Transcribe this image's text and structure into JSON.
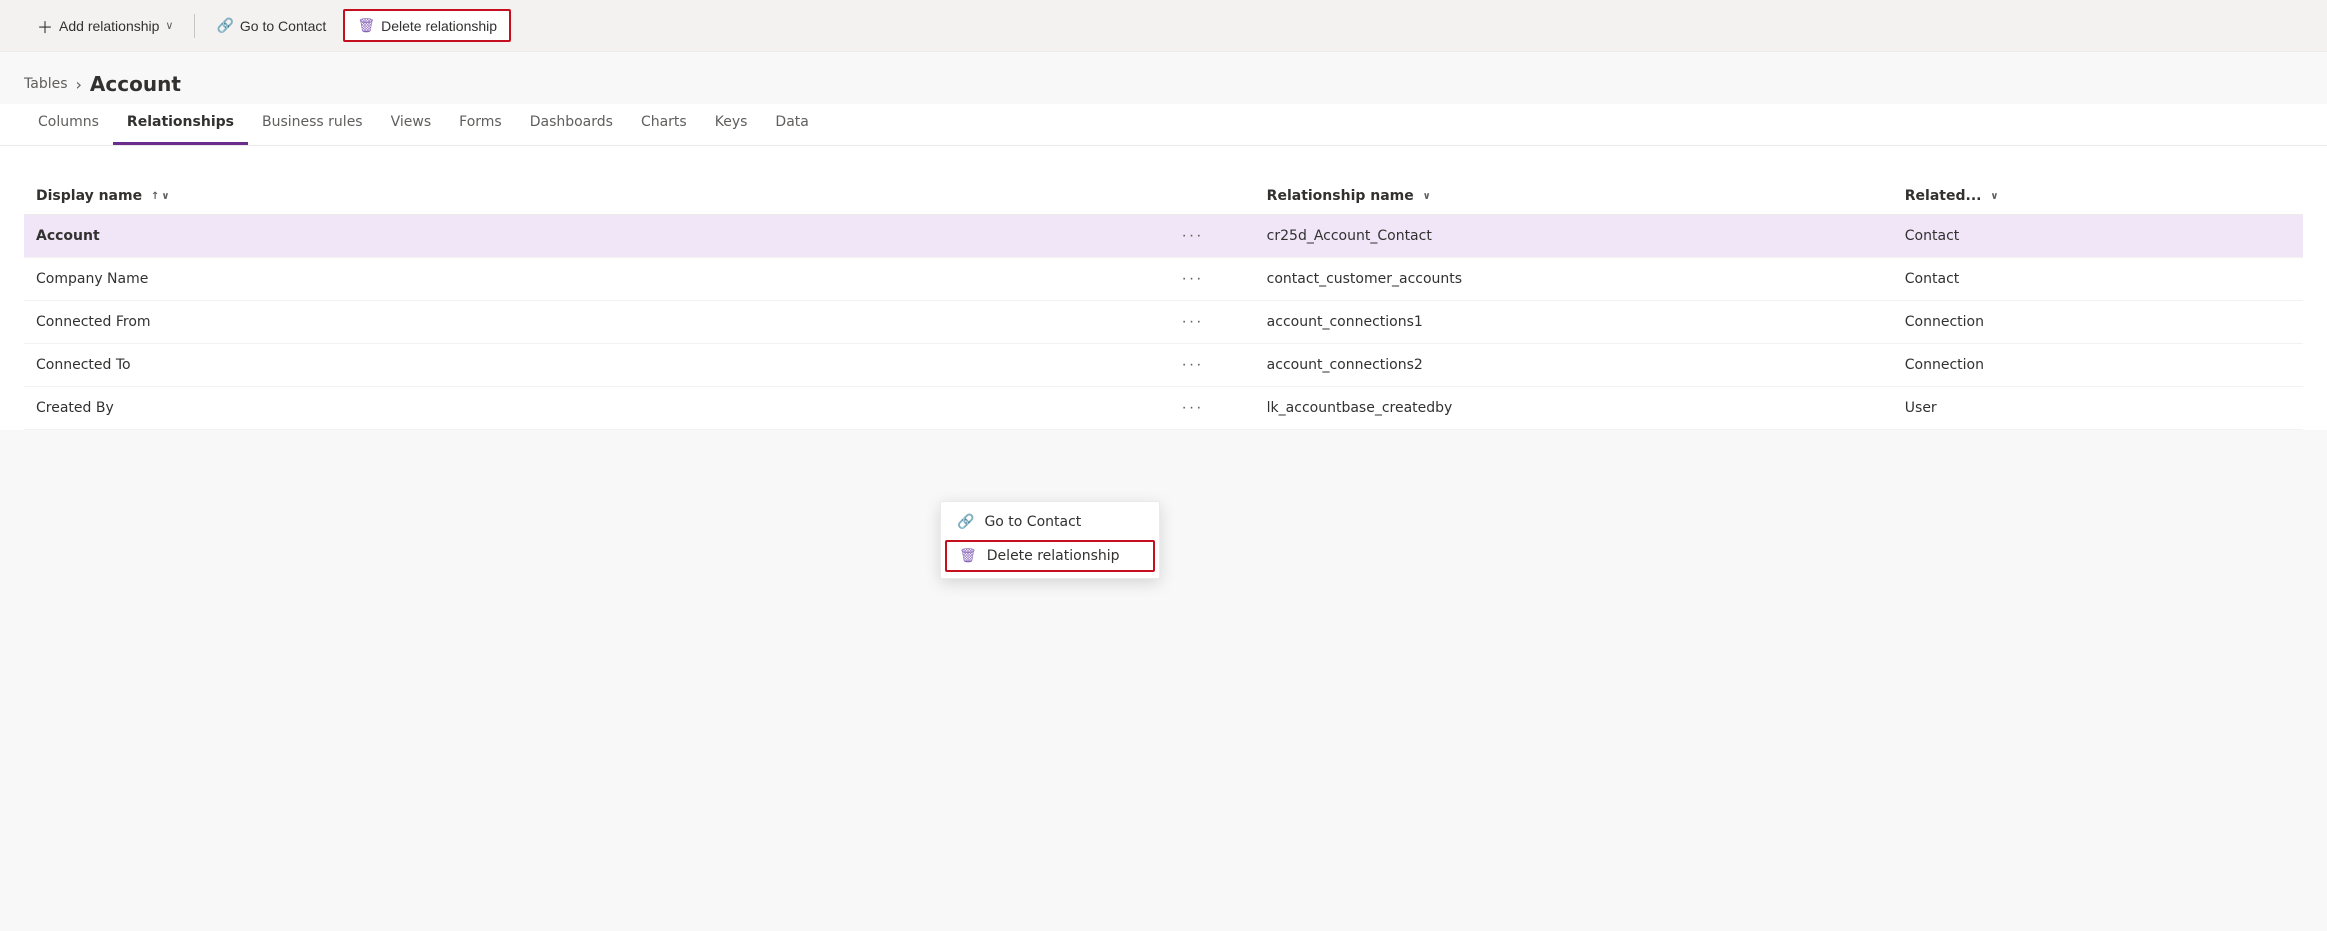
{
  "toolbar": {
    "add_relationship_label": "Add relationship",
    "add_chevron": "∨",
    "go_to_contact_label": "Go to Contact",
    "delete_relationship_label": "Delete relationship"
  },
  "breadcrumb": {
    "parent_label": "Tables",
    "separator": "›",
    "current_label": "Account"
  },
  "tabs": [
    {
      "id": "columns",
      "label": "Columns",
      "active": false
    },
    {
      "id": "relationships",
      "label": "Relationships",
      "active": true
    },
    {
      "id": "business-rules",
      "label": "Business rules",
      "active": false
    },
    {
      "id": "views",
      "label": "Views",
      "active": false
    },
    {
      "id": "forms",
      "label": "Forms",
      "active": false
    },
    {
      "id": "dashboards",
      "label": "Dashboards",
      "active": false
    },
    {
      "id": "charts",
      "label": "Charts",
      "active": false
    },
    {
      "id": "keys",
      "label": "Keys",
      "active": false
    },
    {
      "id": "data",
      "label": "Data",
      "active": false
    }
  ],
  "table": {
    "columns": [
      {
        "id": "display-name",
        "label": "Display name",
        "sortable": true
      },
      {
        "id": "actions",
        "label": "",
        "sortable": false
      },
      {
        "id": "relationship-name",
        "label": "Relationship name",
        "sortable": true
      },
      {
        "id": "related",
        "label": "Related...",
        "sortable": true
      }
    ],
    "rows": [
      {
        "id": "row-1",
        "display_name": "Account",
        "selected": true,
        "dots": "···",
        "rel_name": "cr25d_Account_Contact",
        "related": "Contact"
      },
      {
        "id": "row-2",
        "display_name": "Company Name",
        "selected": false,
        "dots": "···",
        "rel_name": "contact_customer_accounts",
        "related": "Contact"
      },
      {
        "id": "row-3",
        "display_name": "Connected From",
        "selected": false,
        "dots": "···",
        "rel_name": "account_connections1",
        "related": "Connection"
      },
      {
        "id": "row-4",
        "display_name": "Connected To",
        "selected": false,
        "dots": "···",
        "rel_name": "account_connections2",
        "related": "Connection"
      },
      {
        "id": "row-5",
        "display_name": "Created By",
        "selected": false,
        "dots": "···",
        "rel_name": "lk_accountbase_createdby",
        "related": "User"
      }
    ]
  },
  "context_menu": {
    "items": [
      {
        "id": "go-to-contact",
        "label": "Go to Contact",
        "icon": "🔗",
        "highlighted": false
      },
      {
        "id": "delete-relationship",
        "label": "Delete relationship",
        "icon": "🗑",
        "highlighted": true
      }
    ]
  }
}
